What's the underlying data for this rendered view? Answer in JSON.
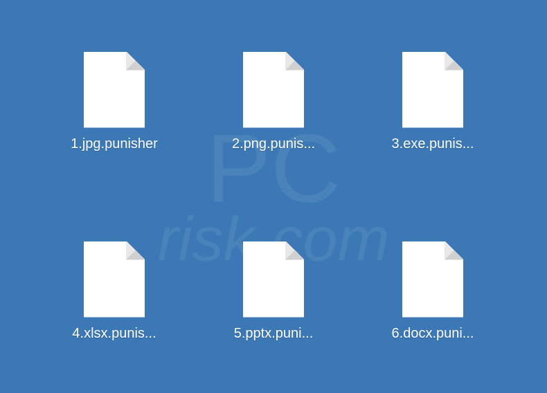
{
  "desktop": {
    "background_color": "#3b78b5"
  },
  "watermark": {
    "line1": "PC",
    "line2": "risk.com"
  },
  "files": [
    {
      "display_name": "1.jpg.punisher"
    },
    {
      "display_name": "2.png.punis..."
    },
    {
      "display_name": "3.exe.punis..."
    },
    {
      "display_name": "4.xlsx.punis..."
    },
    {
      "display_name": "5.pptx.puni..."
    },
    {
      "display_name": "6.docx.puni..."
    }
  ]
}
